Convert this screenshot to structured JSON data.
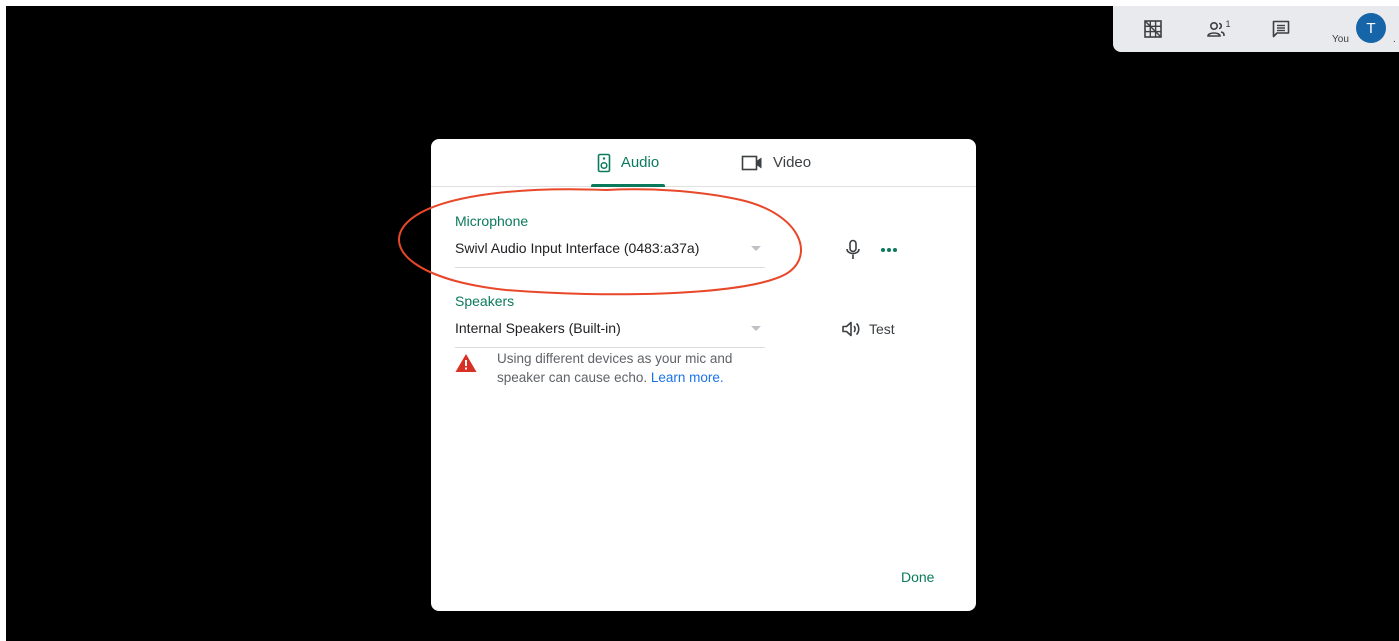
{
  "toolbar": {
    "grid_icon": "grid-layout-icon",
    "participants_icon": "people-icon",
    "participants_count": "1",
    "chat_icon": "chat-icon",
    "you_label": "You",
    "avatar_initial": "T"
  },
  "dialog": {
    "tabs": [
      {
        "label": "Audio",
        "icon": "speaker-device-icon",
        "selected": true
      },
      {
        "label": "Video",
        "icon": "video-camera-icon",
        "selected": false
      }
    ],
    "microphone": {
      "label": "Microphone",
      "value": "Swivl Audio Input Interface (0483:a37a)"
    },
    "speakers": {
      "label": "Speakers",
      "value": "Internal Speakers (Built-in)",
      "test_label": "Test"
    },
    "warning": {
      "text": "Using different devices as your mic and speaker can cause echo.",
      "link": "Learn more."
    },
    "done_label": "Done"
  },
  "colors": {
    "accent": "#0b7a5c",
    "warning": "#d93025",
    "link": "#1a73e8",
    "annotation": "#e8472a"
  }
}
